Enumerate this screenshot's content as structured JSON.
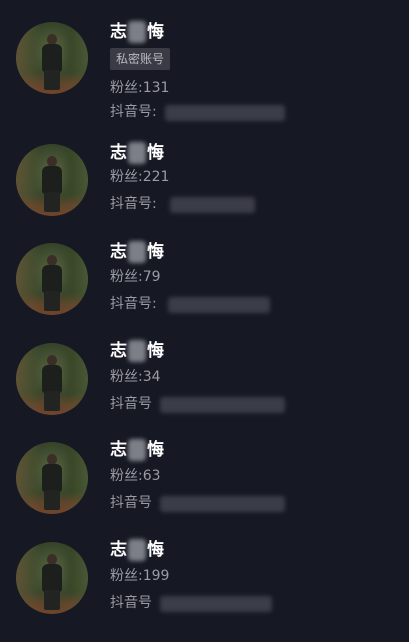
{
  "results": [
    {
      "name_first": "志",
      "name_last": "悔",
      "badge": "私密账号",
      "fans_label": "粉丝:",
      "fans": "131",
      "id_label": "抖音号:"
    },
    {
      "name_first": "志",
      "name_last": "悔",
      "badge": "",
      "fans_label": "粉丝:",
      "fans": "221",
      "id_label": "抖音号:"
    },
    {
      "name_first": "志",
      "name_last": "悔",
      "badge": "",
      "fans_label": "粉丝:",
      "fans": "79",
      "id_label": "抖音号:"
    },
    {
      "name_first": "志",
      "name_last": "悔",
      "badge": "",
      "fans_label": "粉丝:",
      "fans": "34",
      "id_label": "抖音号"
    },
    {
      "name_first": "志",
      "name_last": "悔",
      "badge": "",
      "fans_label": "粉丝:",
      "fans": "63",
      "id_label": "抖音号"
    },
    {
      "name_first": "志",
      "name_last": "悔",
      "badge": "",
      "fans_label": "粉丝:",
      "fans": "199",
      "id_label": "抖音号"
    }
  ],
  "colors": {
    "background": "#161823",
    "name": "#ffffff",
    "meta": "#9a9ba3",
    "badge_bg": "#3a3b45"
  }
}
